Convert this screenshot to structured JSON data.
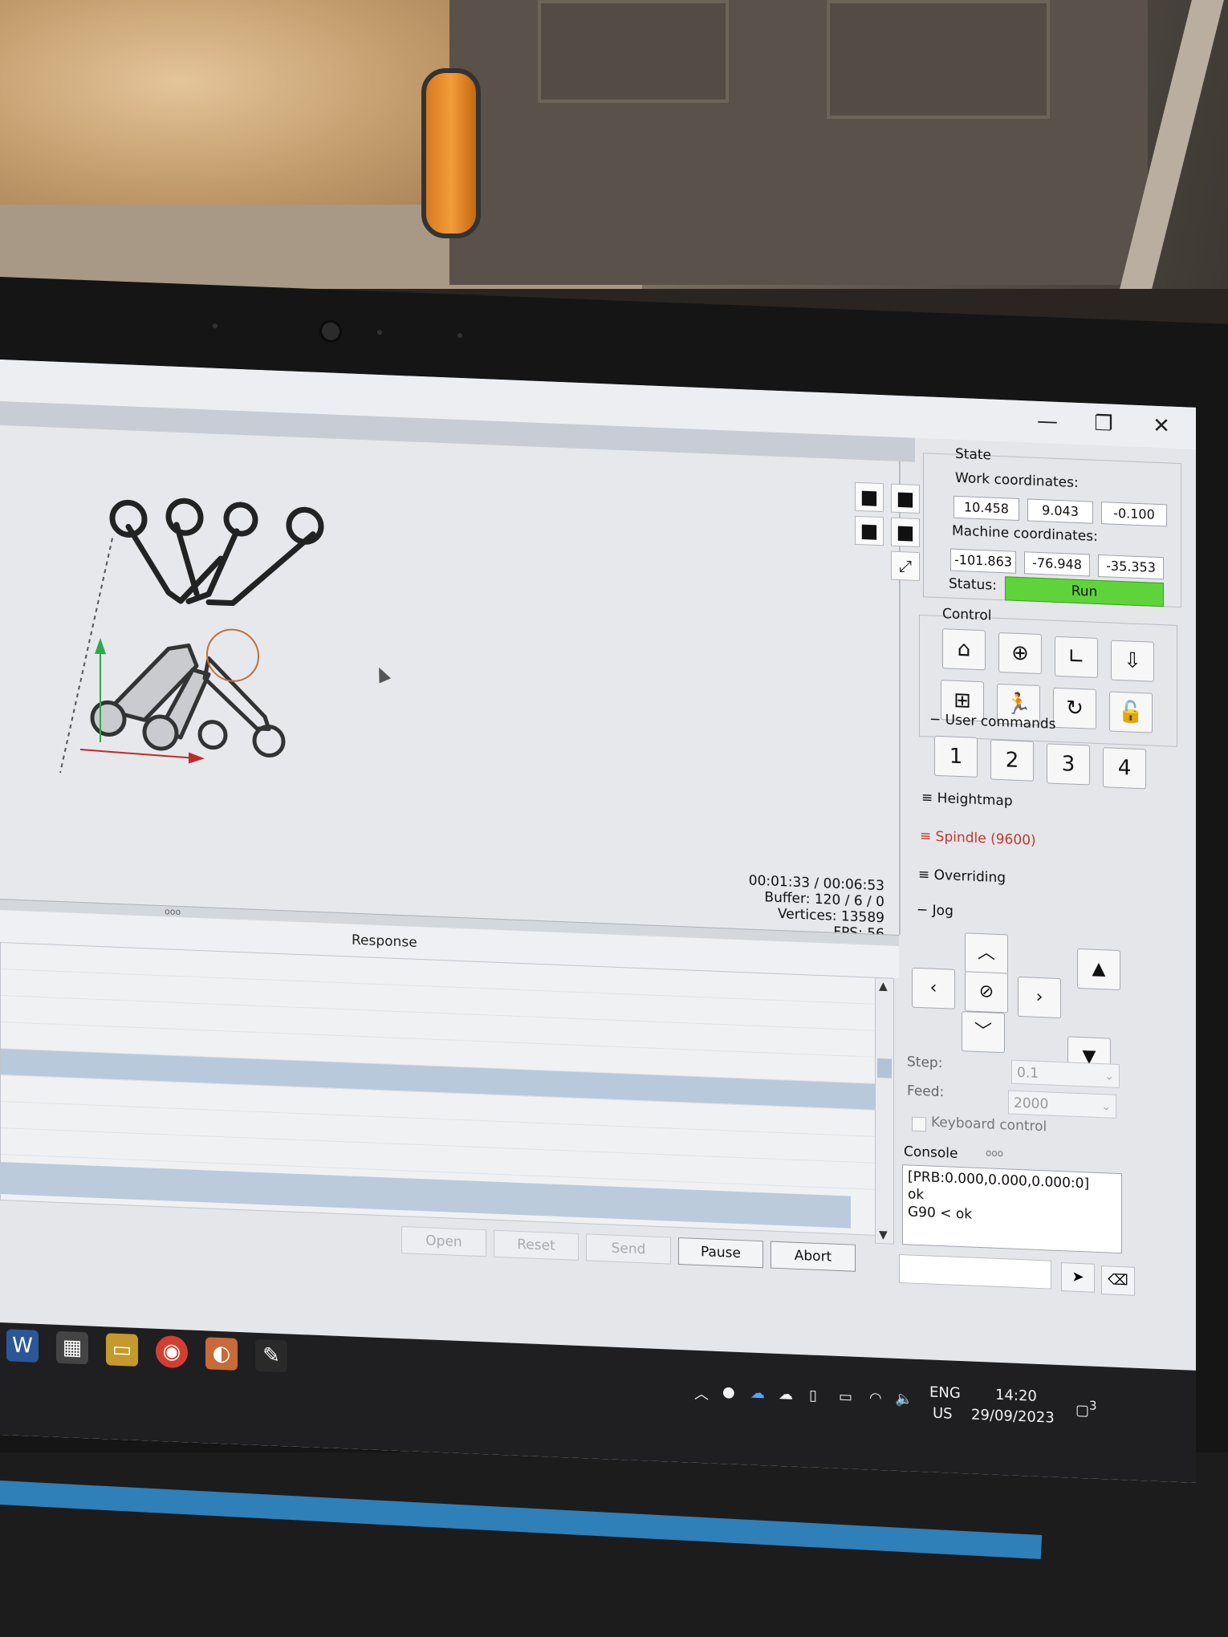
{
  "window": {
    "controls": {
      "minimize": "—",
      "restore": "❐",
      "close": "✕"
    }
  },
  "viewport": {
    "stats": {
      "time": "00:01:33 / 00:06:53",
      "buffer": "Buffer: 120 / 6 / 0",
      "vertices": "Vertices: 13589",
      "fps": "FPS: 56"
    },
    "view_buttons": [
      "cube-front-icon",
      "cube-top-icon",
      "cube-left-icon",
      "cube-iso-icon",
      "fit-icon"
    ]
  },
  "response": {
    "header": "Response",
    "splitter_grip": "ooo"
  },
  "bottom_buttons": {
    "open": "Open",
    "reset": "Reset",
    "send": "Send",
    "pause": "Pause",
    "abort": "Abort"
  },
  "state": {
    "title": "State",
    "work_label": "Work coordinates:",
    "work": [
      "10.458",
      "9.043",
      "-0.100"
    ],
    "machine_label": "Machine coordinates:",
    "machine": [
      "-101.863",
      "-76.948",
      "-35.353"
    ],
    "status_label": "Status:",
    "status_value": "Run",
    "status_color": "#5ed43a"
  },
  "control": {
    "title": "Control",
    "buttons": [
      "home-icon",
      "probe-icon",
      "zero-xy-icon",
      "zero-z-icon",
      "restore-origin-icon",
      "safe-position-icon",
      "reset-icon",
      "unlock-icon"
    ]
  },
  "user_commands": {
    "title": "User commands",
    "buttons": [
      "1",
      "2",
      "3",
      "4"
    ]
  },
  "sections": {
    "heightmap": "Heightmap",
    "spindle": "Spindle (9600)",
    "overriding": "Overriding",
    "jog": "Jog"
  },
  "jog": {
    "step_label": "Step:",
    "step_value": "0.1",
    "feed_label": "Feed:",
    "feed_value": "2000",
    "keyboard_label": "Keyboard control"
  },
  "console": {
    "title": "Console",
    "grip": "ooo",
    "lines": [
      "[PRB:0.000,0.000,0.000:0]",
      "ok",
      "G90 < ok"
    ]
  },
  "taskbar": {
    "language": "ENG",
    "region": "US",
    "time": "14:20",
    "date": "29/09/2023",
    "notifications": "3"
  }
}
